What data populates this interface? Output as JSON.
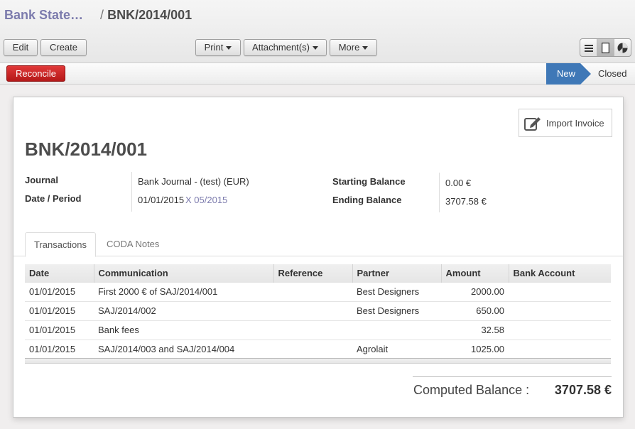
{
  "breadcrumb": {
    "parent": "Bank State…",
    "separator": "/",
    "current": "BNK/2014/001"
  },
  "toolbar": {
    "edit": "Edit",
    "create": "Create",
    "print": "Print",
    "attachments": "Attachment(s)",
    "more": "More"
  },
  "view_switch": {
    "active": "form",
    "icons": [
      "list-icon",
      "form-icon",
      "graph-icon"
    ]
  },
  "statusbar": {
    "reconcile": "Reconcile",
    "states": [
      "New",
      "Closed"
    ],
    "current_state": "New"
  },
  "sheet": {
    "import_invoice": "Import Invoice",
    "title": "BNK/2014/001",
    "fields": {
      "journal_label": "Journal",
      "journal_value": "Bank Journal - (test) (EUR)",
      "date_label": "Date / Period",
      "date_value": "01/01/2015",
      "period_value": "X 05/2015",
      "starting_label": "Starting Balance",
      "starting_value": "0.00 €",
      "ending_label": "Ending Balance",
      "ending_value": "3707.58 €"
    },
    "tabs": [
      "Transactions",
      "CODA Notes"
    ],
    "active_tab": "Transactions",
    "table": {
      "headers": [
        "Date",
        "Communication",
        "Reference",
        "Partner",
        "Amount",
        "Bank Account"
      ],
      "rows": [
        [
          "01/01/2015",
          "First 2000 € of SAJ/2014/001",
          "",
          "Best Designers",
          "2000.00",
          ""
        ],
        [
          "01/01/2015",
          "SAJ/2014/002",
          "",
          "Best Designers",
          "650.00",
          ""
        ],
        [
          "01/01/2015",
          "Bank fees",
          "",
          "",
          "32.58",
          ""
        ],
        [
          "01/01/2015",
          "SAJ/2014/003 and SAJ/2014/004",
          "",
          "Agrolait",
          "1025.00",
          ""
        ]
      ]
    },
    "computed_label": "Computed Balance :",
    "computed_value": "3707.58 €"
  },
  "colors": {
    "link": "#7c7bad",
    "reconcile": "#c62222",
    "status_active": "#3f78b7"
  }
}
